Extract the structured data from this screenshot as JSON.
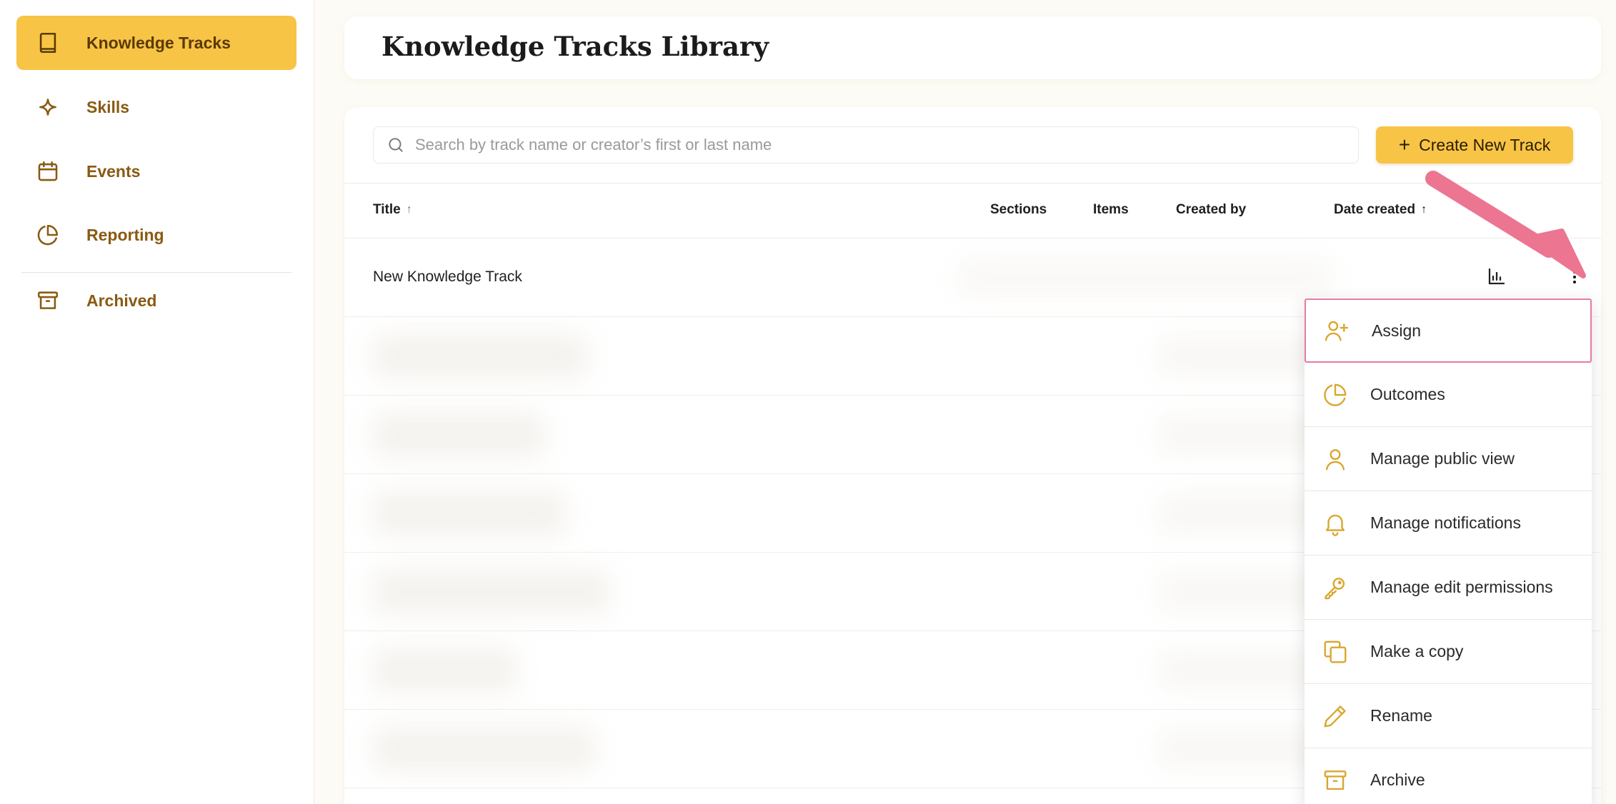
{
  "sidebar": {
    "items": [
      {
        "label": "Knowledge Tracks",
        "icon": "book-icon",
        "active": true
      },
      {
        "label": "Skills",
        "icon": "sparkle-icon",
        "active": false
      },
      {
        "label": "Events",
        "icon": "calendar-icon",
        "active": false
      },
      {
        "label": "Reporting",
        "icon": "pie-chart-icon",
        "active": false
      },
      {
        "label": "Archived",
        "icon": "archive-icon",
        "active": false
      }
    ]
  },
  "header": {
    "title": "Knowledge Tracks Library"
  },
  "search": {
    "placeholder": "Search by track name or creator’s first or last name"
  },
  "toolbar": {
    "create_label": "Create New Track"
  },
  "table": {
    "columns": {
      "title": "Title",
      "sections": "Sections",
      "items": "Items",
      "created_by": "Created by",
      "date_created": "Date created"
    },
    "rows": [
      {
        "title": "New Knowledge Track"
      }
    ]
  },
  "menu": {
    "items": [
      {
        "label": "Assign",
        "icon": "user-plus-icon"
      },
      {
        "label": "Outcomes",
        "icon": "pie-chart-icon"
      },
      {
        "label": "Manage public view",
        "icon": "user-icon"
      },
      {
        "label": "Manage notifications",
        "icon": "bell-icon"
      },
      {
        "label": "Manage edit permissions",
        "icon": "key-icon"
      },
      {
        "label": "Make a copy",
        "icon": "copy-icon"
      },
      {
        "label": "Rename",
        "icon": "pencil-icon"
      },
      {
        "label": "Archive",
        "icon": "archive-icon"
      }
    ]
  },
  "colors": {
    "accent": "#f7c446",
    "nav_text": "#8a5a12",
    "icon_gold": "#d9a62e",
    "annotation": "#ec7592"
  }
}
